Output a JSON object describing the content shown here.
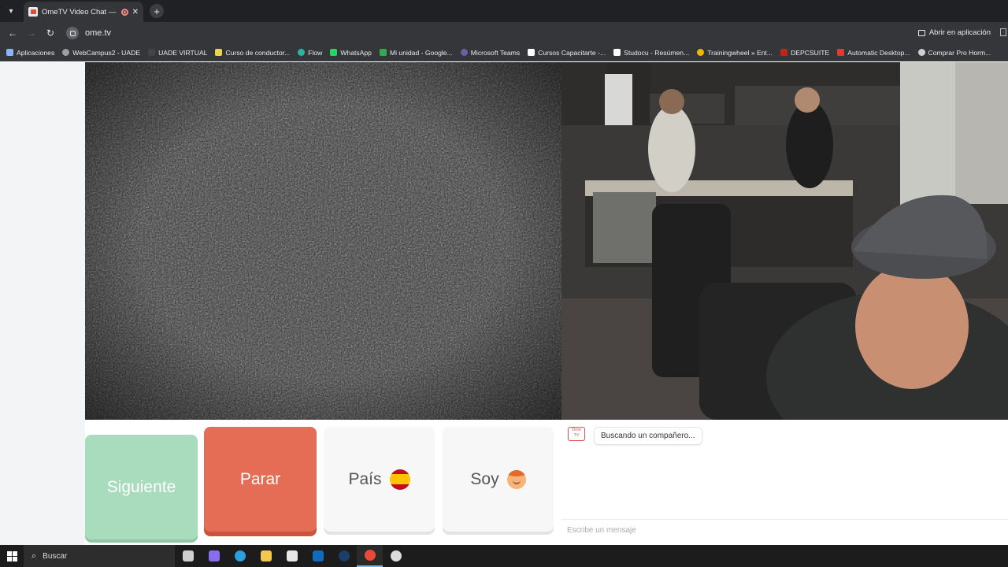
{
  "browser": {
    "tab_title": "OmeTV Video Chat — Ome",
    "tab_close": "✕",
    "new_tab": "+",
    "url": "ome.tv",
    "open_in_app": "Abrir en aplicación"
  },
  "bookmarks": [
    {
      "label": "Aplicaciones",
      "color": "#8ab4f8",
      "icon": "apps-icon"
    },
    {
      "label": "WebCampus2 - UADE",
      "color": "#9aa0a6",
      "icon": "globe-icon"
    },
    {
      "label": "UADE VIRTUAL",
      "color": "#444444",
      "icon": "uade-icon"
    },
    {
      "label": "Curso de conductor...",
      "color": "#e8d44d",
      "icon": "folder-icon"
    },
    {
      "label": "Flow",
      "color": "#2bb5a0",
      "icon": "flow-icon"
    },
    {
      "label": "WhatsApp",
      "color": "#25d366",
      "icon": "whatsapp-icon"
    },
    {
      "label": "Mi unidad - Google...",
      "color": "#34a853",
      "icon": "drive-icon"
    },
    {
      "label": "Microsoft Teams",
      "color": "#6264a7",
      "icon": "teams-icon"
    },
    {
      "label": "Cursos Capacitarte -...",
      "color": "#ffffff",
      "icon": "capacitarte-icon"
    },
    {
      "label": "Studocu - Resúmen...",
      "color": "#ffffff",
      "icon": "studocu-icon"
    },
    {
      "label": "Trainingwheel » Ent...",
      "color": "#f4b400",
      "icon": "trainingwheel-icon"
    },
    {
      "label": "DEPCSUITE",
      "color": "#c5221f",
      "icon": "depcsuite-icon"
    },
    {
      "label": "Automatic Desktop...",
      "color": "#e53935",
      "icon": "desktop-icon"
    },
    {
      "label": "Comprar Pro Horm...",
      "color": "#cfcfcf",
      "icon": "user-icon"
    }
  ],
  "controls": {
    "next_label": "Siguiente",
    "stop_label": "Parar",
    "country_label": "País",
    "gender_label": "Soy"
  },
  "chat": {
    "bot_icon_text": "Ome TV",
    "status_message": "Buscando un compañero...",
    "input_placeholder": "Escribe un mensaje"
  },
  "taskbar": {
    "search_label": "Buscar",
    "apps": [
      {
        "name": "task-view-icon",
        "color": "#cfcfcf"
      },
      {
        "name": "copilot-icon",
        "color": "#8a6cf0"
      },
      {
        "name": "edge-icon",
        "color": "#2d9fe0"
      },
      {
        "name": "file-explorer-icon",
        "color": "#f2c94c"
      },
      {
        "name": "store-icon",
        "color": "#e8e8e8"
      },
      {
        "name": "outlook-icon",
        "color": "#0f6cbd"
      },
      {
        "name": "steam-icon",
        "color": "#1b3d66"
      },
      {
        "name": "chrome-icon",
        "color": "#e84a3a"
      },
      {
        "name": "obs-icon",
        "color": "#dddddd"
      }
    ]
  },
  "colors": {
    "next_button": "#a8dcbd",
    "stop_button": "#e56d55",
    "neutral_button": "#f7f7f7"
  }
}
